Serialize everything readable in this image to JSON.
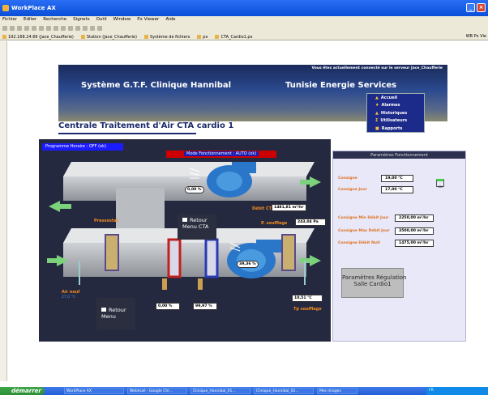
{
  "window": {
    "title": "WorkPlace AX"
  },
  "menubar": [
    "Fichier",
    "Editer",
    "Recherche",
    "Signets",
    "Outil",
    "Window",
    "Px Viewer",
    "Aide"
  ],
  "favorites": [
    "192.168.24.66 (Jace_Chaufferie)",
    "Station (Jace_Chaufferie)",
    "Système de fichiers",
    "px",
    "CTA_Cardio1.px"
  ],
  "favorites_right": "WB Px Vie",
  "banner": {
    "connected": "Vous êtes actuellement connecté sur le serveur Jace_Chaufferie",
    "title_left": "Système G.T.F. Clinique Hannibal",
    "title_right": "Tunisie Energie Services"
  },
  "nav": [
    {
      "label": "Accueil",
      "icon": "home-icon"
    },
    {
      "label": "Alarmes",
      "icon": "alarm-icon"
    },
    {
      "label": "Historiques",
      "icon": "history-icon"
    },
    {
      "label": "Utilisateurs",
      "icon": "users-icon"
    },
    {
      "label": "Rapports",
      "icon": "report-icon"
    }
  ],
  "page_title": "Centrale Traitement d'Air CTA cardio 1",
  "scada": {
    "programme": "Programme Horaire : OFF (ok)",
    "mode": "Mode Fonctionnement : AUTO (ok)",
    "fan_top": "0,00 %",
    "fan_bottom": "39,36 %",
    "debit_label": "Débit CTA",
    "debit_value": "1481,81 m³/hr",
    "psoufflage_label": "P. soufflage",
    "psoufflage_value": "243,04 Pa",
    "pressostat": "Pressostat",
    "retour_menu_cta": "Retour\nMenu CTA",
    "air_neuf": "Air neuf",
    "air_neuf_temp": "27,0 °C",
    "valve1": "0,00 %",
    "valve2": "99,97 %",
    "tp_value": "10,51 °C",
    "tp_label": "Tp soufflage",
    "retour_menu": "Retour\nMenu"
  },
  "params": {
    "title": "Paramètres Fonctionnement",
    "consigne": "Consigne",
    "consigne_val": "19,00 °C",
    "consigne_jour": "Consigne Jour",
    "consigne_jour_val": "17,00 °C",
    "on_label": "ON",
    "min": "Consigne Min Débit Jour",
    "min_val": "2250,00 m³/hr",
    "max": "Consigne Max Débit Jour",
    "max_val": "3500,00 m³/hr",
    "nuit": "Consigne Débit Nuit",
    "nuit_val": "1475,00 m³/hr",
    "regulation": "Paramètres Régulation\nSalle Cardio1"
  },
  "taskbar": {
    "start": "démarrer",
    "tasks": [
      "WorkPlace AX",
      "Webmail - Google Chr...",
      "Clinique_Hannibal_01...",
      "Clinique_Hannibal_02...",
      "Mes images"
    ],
    "tray": "FR"
  }
}
